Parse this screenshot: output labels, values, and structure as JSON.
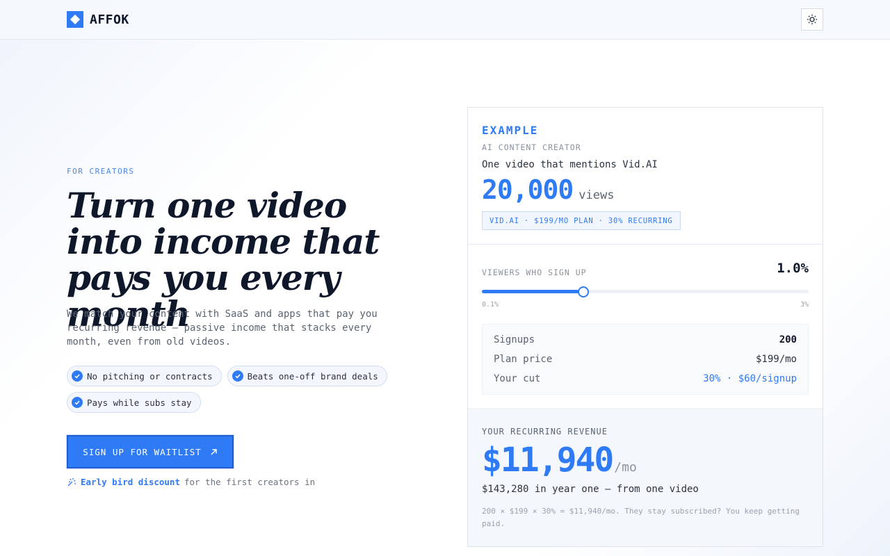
{
  "header": {
    "brand": "AFFOK",
    "theme_icon": "sun-icon"
  },
  "hero": {
    "eyebrow": "FOR CREATORS",
    "headline": "Turn one video into income that pays you every month",
    "lede": "We match your content with SaaS and apps that pay you recurring revenue — passive income that stacks every month, even from old videos.",
    "pills": [
      "No pitching or contracts",
      "Beats one-off brand deals",
      "Pays while subs stay"
    ],
    "cta_label": "SIGN UP FOR WAITLIST",
    "earlybird_strong": "Early bird discount",
    "earlybird_rest": "for the first creators in"
  },
  "example": {
    "title": "EXAMPLE",
    "subtitle": "AI CONTENT CREATOR",
    "description": "One video that mentions Vid.AI",
    "views_number": "20,000",
    "views_unit": "views",
    "tag": "VID.AI · $199/MO PLAN · 30% RECURRING"
  },
  "calculator": {
    "label": "VIEWERS WHO SIGN UP",
    "value": "1.0%",
    "slider": {
      "min": 0.1,
      "max": 3,
      "value": 1.0,
      "min_label": "0.1%",
      "max_label": "3%"
    },
    "rows": [
      {
        "key": "Signups",
        "value": "200"
      },
      {
        "key": "Plan price",
        "value": "$199/mo"
      },
      {
        "key": "Your cut",
        "value": "30% · $60/signup"
      }
    ]
  },
  "revenue": {
    "label": "YOUR RECURRING REVENUE",
    "amount": "$11,940",
    "unit": "/mo",
    "year_line": "$143,280 in year one — from one video",
    "note": "200 × $199 × 30% = $11,940/mo. They stay subscribed? You keep getting paid."
  },
  "colors": {
    "accent": "#2f7af5",
    "ink": "#0f172a"
  }
}
